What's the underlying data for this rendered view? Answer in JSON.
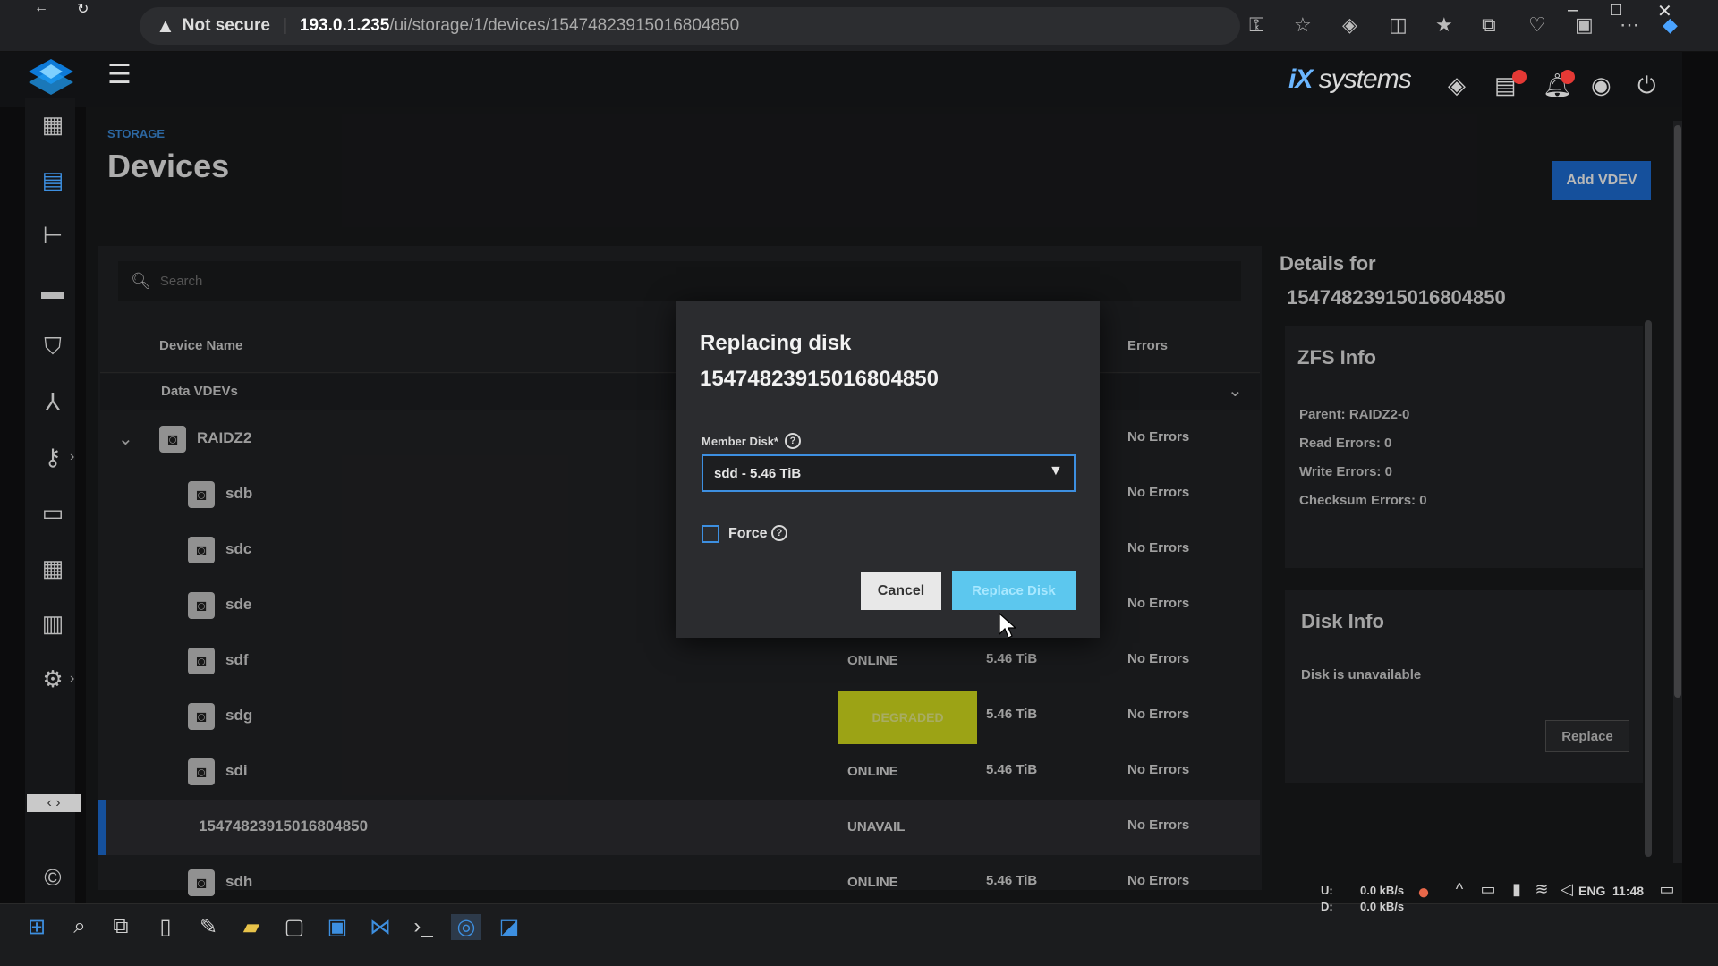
{
  "browser": {
    "security_label": "Not secure",
    "url_host": "193.0.1.235",
    "url_path": "/ui/storage/1/devices/15474823915016804850"
  },
  "header": {
    "brand_prefix": "iX",
    "brand_suffix": "systems"
  },
  "page": {
    "breadcrumb": "STORAGE",
    "title": "Devices",
    "add_vdev_label": "Add VDEV"
  },
  "table": {
    "search_placeholder": "Search",
    "col_device_name": "Device Name",
    "col_errors": "Errors",
    "group_label": "Data VDEVs",
    "vdev": {
      "name": "RAIDZ2",
      "errors": "No Errors"
    },
    "rows": [
      {
        "name": "sdb",
        "status": "",
        "size": "",
        "errors": "No Errors"
      },
      {
        "name": "sdc",
        "status": "",
        "size": "",
        "errors": "No Errors"
      },
      {
        "name": "sde",
        "status": "",
        "size": "",
        "errors": "No Errors"
      },
      {
        "name": "sdf",
        "status": "ONLINE",
        "size": "5.46 TiB",
        "errors": "No Errors"
      },
      {
        "name": "sdg",
        "status": "DEGRADED",
        "size": "5.46 TiB",
        "errors": "No Errors"
      },
      {
        "name": "sdi",
        "status": "ONLINE",
        "size": "5.46 TiB",
        "errors": "No Errors"
      },
      {
        "name": "15474823915016804850",
        "status": "UNAVAIL",
        "size": "",
        "errors": "No Errors"
      },
      {
        "name": "sdh",
        "status": "ONLINE",
        "size": "5.46 TiB",
        "errors": "No Errors"
      }
    ]
  },
  "details": {
    "title": "Details for",
    "id": "15474823915016804850",
    "zfs_title": "ZFS Info",
    "parent": "Parent: RAIDZ2-0",
    "read_errors": "Read Errors: 0",
    "write_errors": "Write Errors: 0",
    "checksum_errors": "Checksum Errors: 0",
    "disk_title": "Disk Info",
    "disk_status": "Disk is unavailable",
    "replace_label": "Replace"
  },
  "modal": {
    "title": "Replacing disk",
    "disk_id": "15474823915016804850",
    "member_label": "Member Disk*",
    "member_value": "sdd - 5.46 TiB",
    "force_label": "Force",
    "cancel_label": "Cancel",
    "replace_label": "Replace Disk"
  },
  "taskbar": {
    "net_up_label": "U:",
    "net_down_label": "D:",
    "net_up": "0.0 kB/s",
    "net_down": "0.0 kB/s",
    "lang": "ENG",
    "time": "11:48"
  },
  "colors": {
    "accent": "#1e6fd9",
    "degraded": "#d9e21e",
    "replace_button": "#5cc7ee"
  }
}
